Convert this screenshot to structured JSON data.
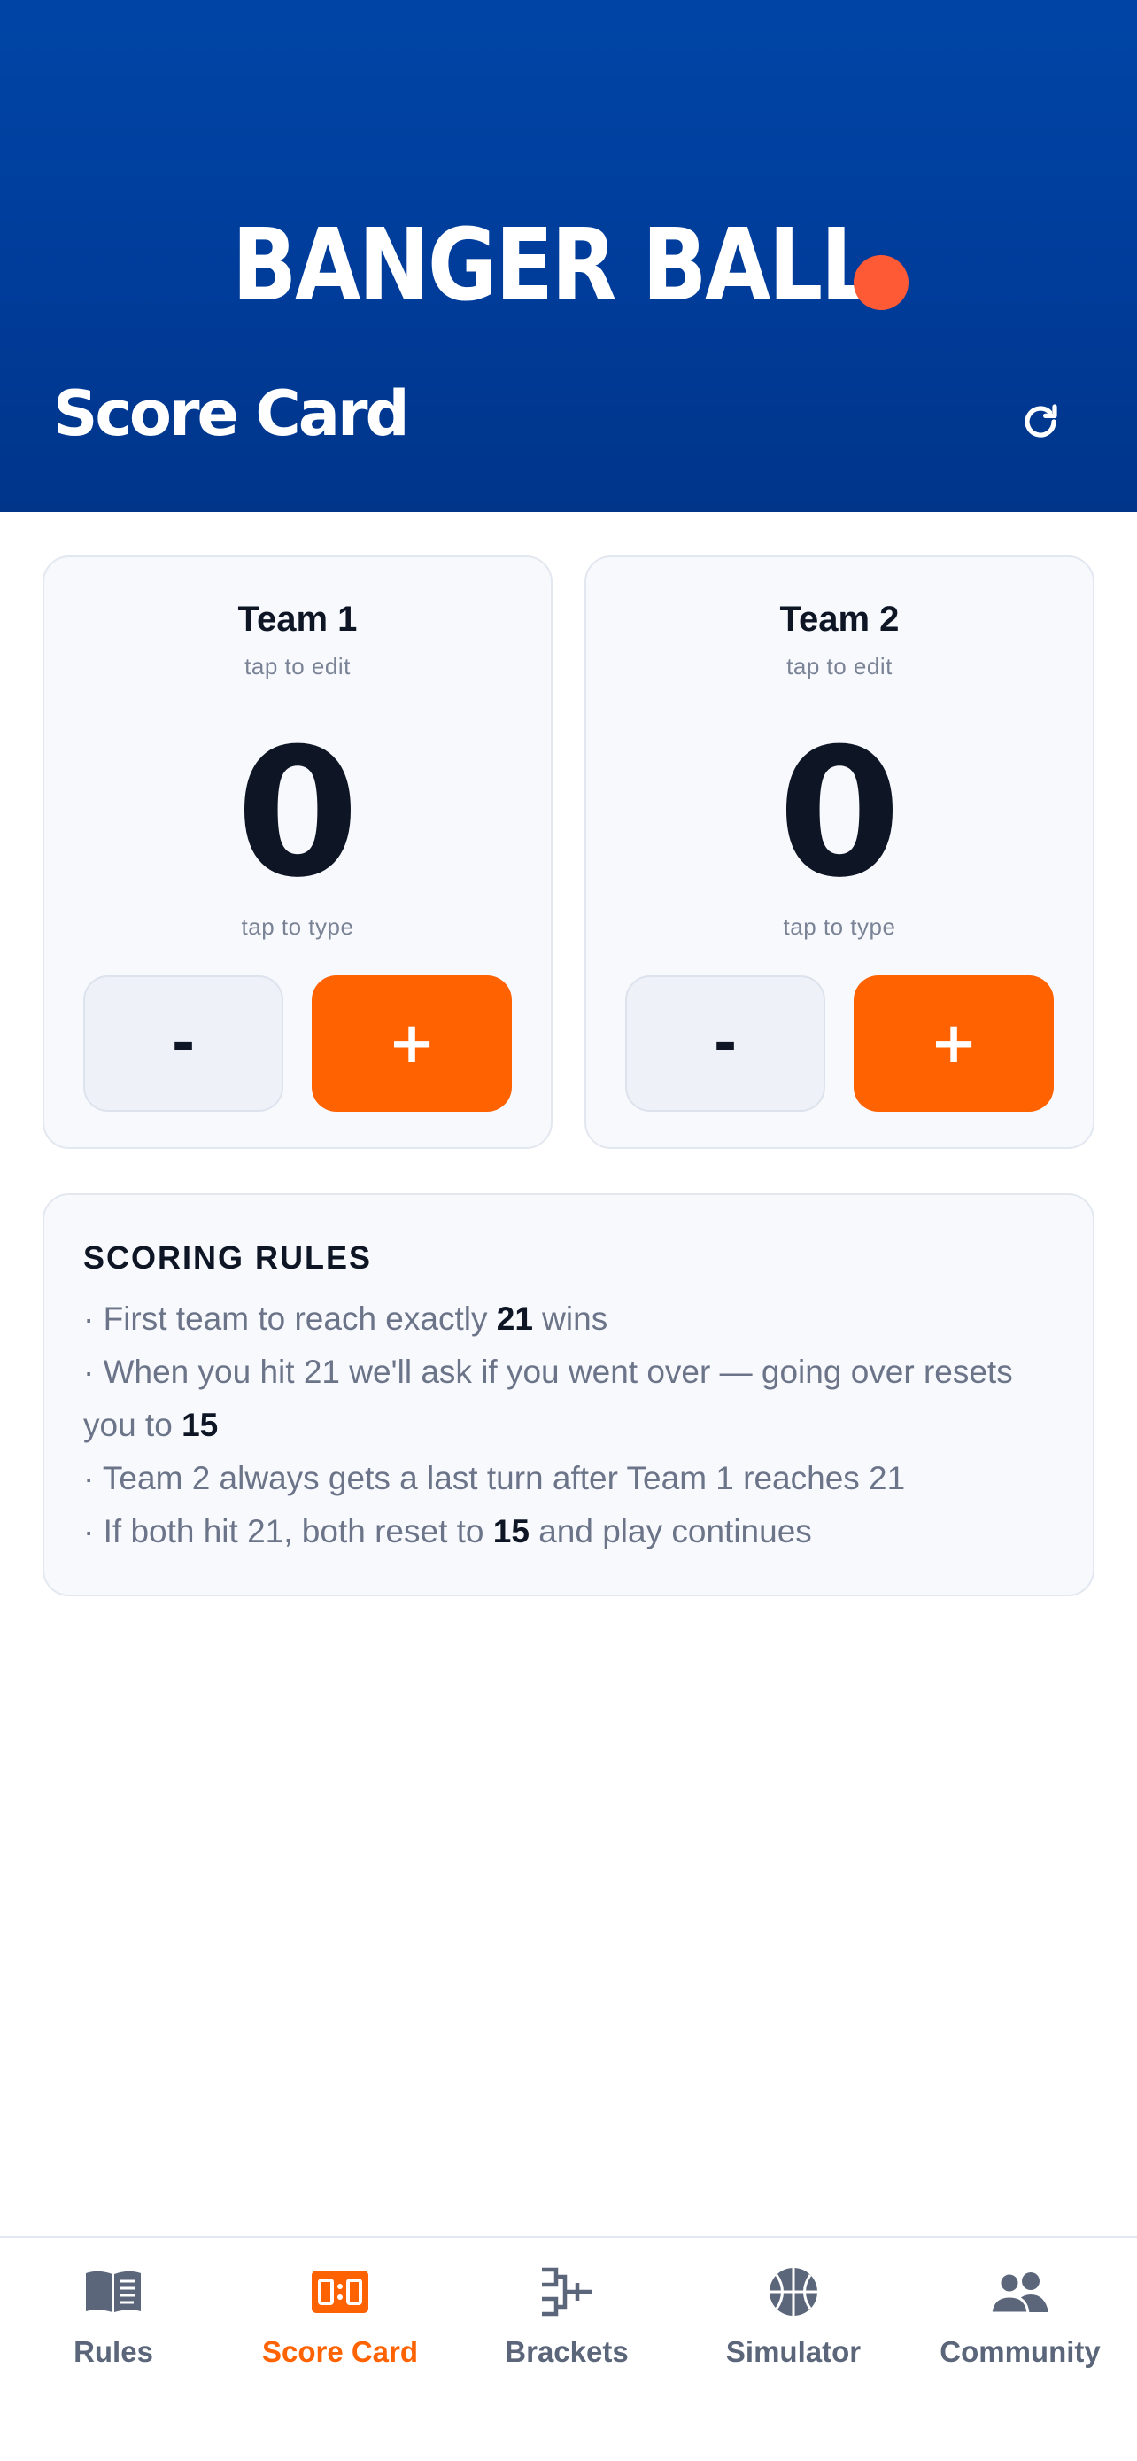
{
  "colors": {
    "brand_blue": "#0045A6",
    "accent_orange": "#FF6200",
    "logo_dot": "#FF5A36",
    "text_dark": "#0E1626",
    "text_muted": "#6B7488",
    "nav_inactive": "#5C667A"
  },
  "header": {
    "logo_text": "BANGER BALL",
    "title": "Score Card",
    "refresh_icon": "refresh-icon"
  },
  "teams": [
    {
      "name": "Team 1",
      "edit_hint": "tap to edit",
      "score": "0",
      "type_hint": "tap to type",
      "minus_label": "-",
      "plus_label": "+"
    },
    {
      "name": "Team 2",
      "edit_hint": "tap to edit",
      "score": "0",
      "type_hint": "tap to type",
      "minus_label": "-",
      "plus_label": "+"
    }
  ],
  "rules": {
    "title": "SCORING RULES",
    "lines": [
      {
        "before": "· First team to reach exactly ",
        "bold": "21",
        "after": " wins"
      },
      {
        "before": "· When you hit 21 we'll ask if you went over — going over resets you to ",
        "bold": "15",
        "after": ""
      },
      {
        "before": "· Team 2 always gets a last turn after Team 1 reaches 21",
        "bold": "",
        "after": ""
      },
      {
        "before": "· If both hit 21, both reset to ",
        "bold": "15",
        "after": " and play continues"
      }
    ]
  },
  "nav": {
    "active": "Score Card",
    "items": [
      {
        "label": "Rules",
        "icon": "book-icon"
      },
      {
        "label": "Score Card",
        "icon": "scoreboard-icon"
      },
      {
        "label": "Brackets",
        "icon": "bracket-icon"
      },
      {
        "label": "Simulator",
        "icon": "basketball-icon"
      },
      {
        "label": "Community",
        "icon": "users-icon"
      }
    ]
  }
}
